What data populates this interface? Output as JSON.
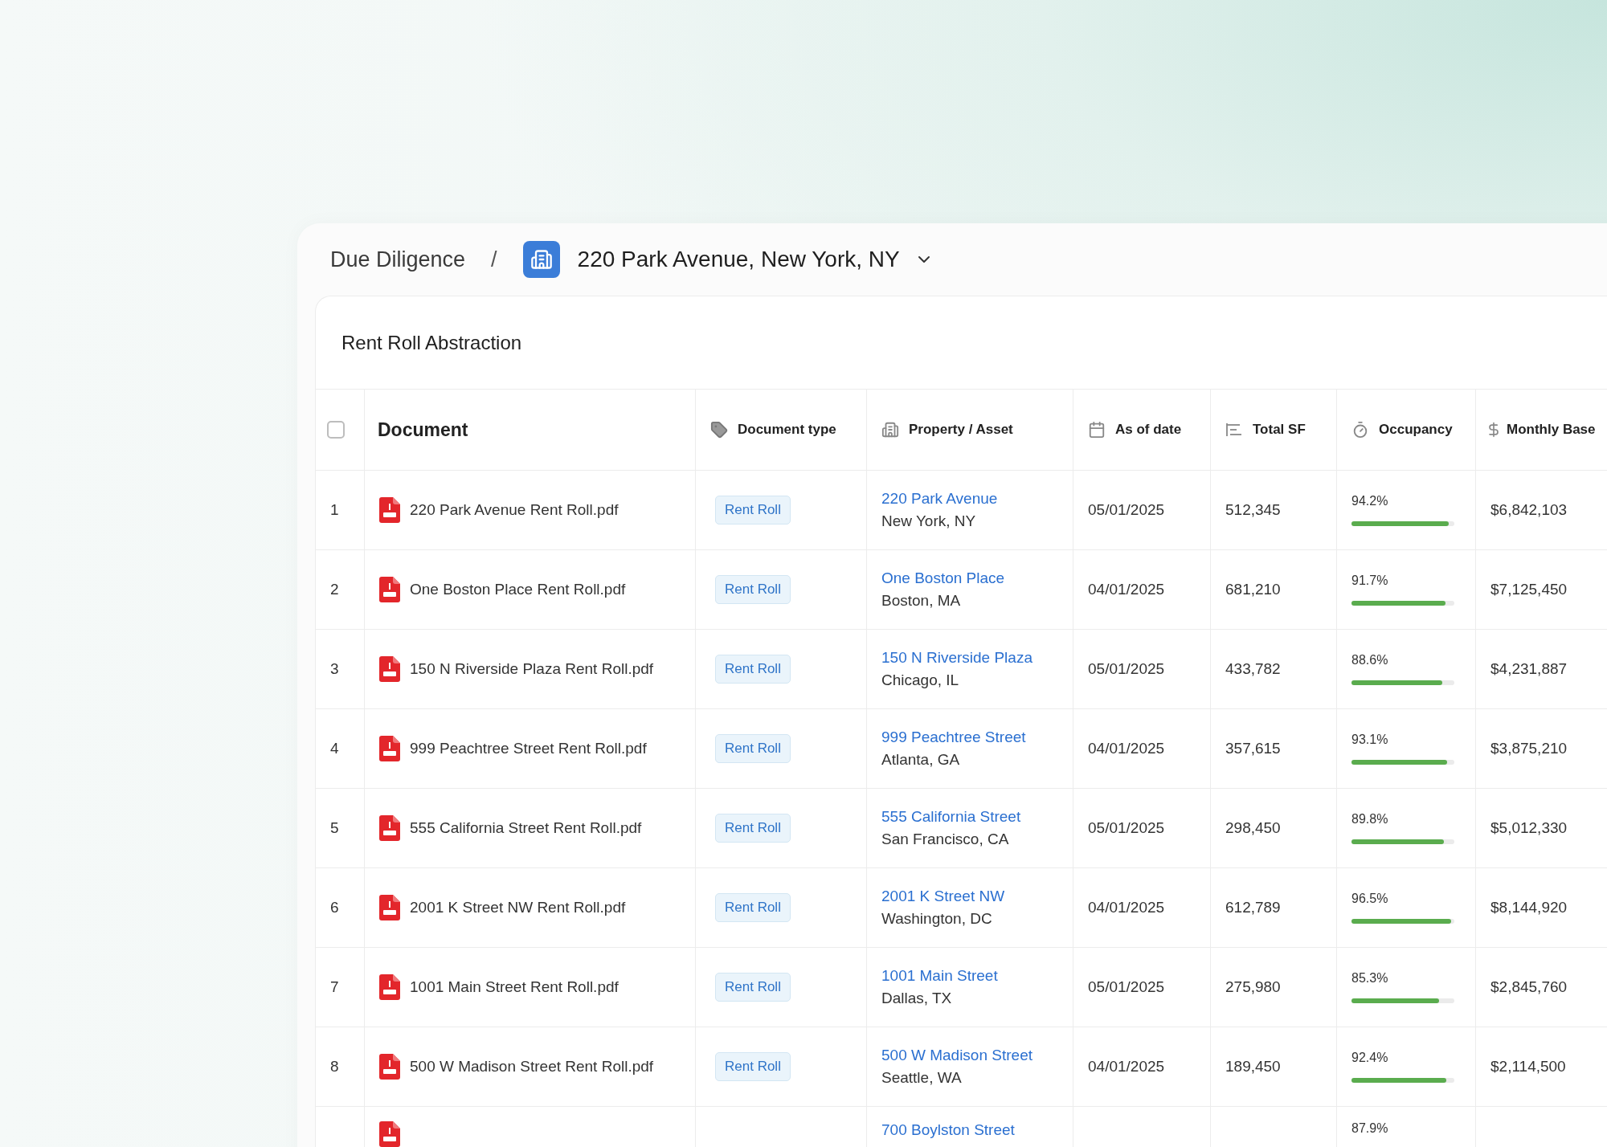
{
  "breadcrumb": {
    "parent": "Due Diligence",
    "separator": "/",
    "current": "220 Park Avenue, New York, NY"
  },
  "panel": {
    "title": "Rent Roll Abstraction"
  },
  "table": {
    "header_checkbox": {
      "checked": false
    },
    "columns": [
      {
        "label": "Document"
      },
      {
        "label": "Document type"
      },
      {
        "label": "Property / Asset"
      },
      {
        "label": "As of date"
      },
      {
        "label": "Total SF"
      },
      {
        "label": "Occupancy"
      },
      {
        "label": "Monthly Base"
      }
    ],
    "rows": [
      {
        "number": "1",
        "document": "220 Park Avenue Rent Roll.pdf",
        "document_type": "Rent Roll",
        "property": "220 Park Avenue",
        "location": "New York, NY",
        "as_of_date": "05/01/2025",
        "total_sf": "512,345",
        "occupancy": "94.2%",
        "level": 0.942,
        "monthly_base": "$6,842,103"
      },
      {
        "number": "2",
        "document": "One Boston Place Rent Roll.pdf",
        "document_type": "Rent Roll",
        "property": "One Boston Place",
        "location": "Boston, MA",
        "as_of_date": "04/01/2025",
        "total_sf": "681,210",
        "occupancy": "91.7%",
        "level": 0.917,
        "monthly_base": "$7,125,450"
      },
      {
        "number": "3",
        "document": "150 N Riverside Plaza Rent Roll.pdf",
        "document_type": "Rent Roll",
        "property": "150 N Riverside Plaza",
        "location": "Chicago, IL",
        "as_of_date": "05/01/2025",
        "total_sf": "433,782",
        "occupancy": "88.6%",
        "level": 0.886,
        "monthly_base": "$4,231,887"
      },
      {
        "number": "4",
        "document": "999 Peachtree Street Rent Roll.pdf",
        "document_type": "Rent Roll",
        "property": "999 Peachtree Street",
        "location": "Atlanta, GA",
        "as_of_date": "04/01/2025",
        "total_sf": "357,615",
        "occupancy": "93.1%",
        "level": 0.931,
        "monthly_base": "$3,875,210"
      },
      {
        "number": "5",
        "document": "555 California Street Rent Roll.pdf",
        "document_type": "Rent Roll",
        "property": "555 California Street",
        "location": "San Francisco, CA",
        "as_of_date": "05/01/2025",
        "total_sf": "298,450",
        "occupancy": "89.8%",
        "level": 0.898,
        "monthly_base": "$5,012,330"
      },
      {
        "number": "6",
        "document": "2001 K Street NW Rent Roll.pdf",
        "document_type": "Rent Roll",
        "property": "2001 K Street NW",
        "location": "Washington, DC",
        "as_of_date": "04/01/2025",
        "total_sf": "612,789",
        "occupancy": "96.5%",
        "level": 0.965,
        "monthly_base": "$8,144,920"
      },
      {
        "number": "7",
        "document": "1001 Main Street Rent Roll.pdf",
        "document_type": "Rent Roll",
        "property": "1001 Main Street",
        "location": "Dallas, TX",
        "as_of_date": "05/01/2025",
        "total_sf": "275,980",
        "occupancy": "85.3%",
        "level": 0.853,
        "monthly_base": "$2,845,760"
      },
      {
        "number": "8",
        "document": "500 W Madison Street Rent Roll.pdf",
        "document_type": "Rent Roll",
        "property": "500 W Madison Street",
        "location": "Seattle, WA",
        "as_of_date": "04/01/2025",
        "total_sf": "189,450",
        "occupancy": "92.4%",
        "level": 0.924,
        "monthly_base": "$2,114,500"
      },
      {
        "property": "700 Boylston Street",
        "occupancy": "87.9%"
      }
    ]
  }
}
